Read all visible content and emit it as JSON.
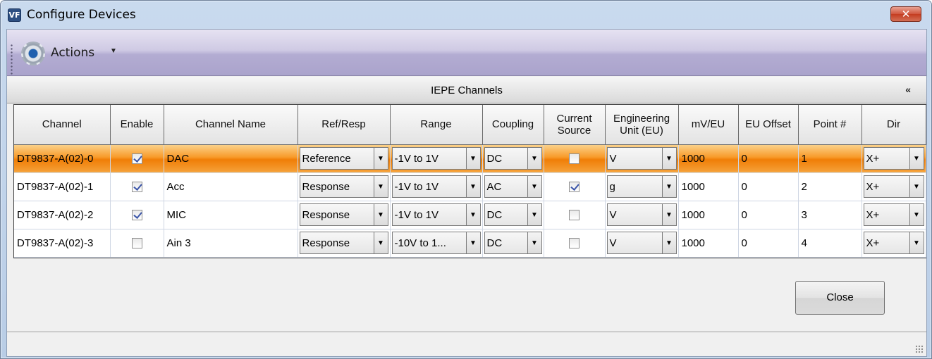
{
  "window": {
    "icon_text": "VF",
    "title": "Configure Devices",
    "close_glyph": "✕"
  },
  "toolbar": {
    "actions_label": "Actions",
    "actions_icon": "gear-icon"
  },
  "grid": {
    "caption": "IEPE Channels",
    "collapse_glyph": "≈",
    "columns": [
      "Channel",
      "Enable",
      "Channel Name",
      "Ref/Resp",
      "Range",
      "Coupling",
      "Current Source",
      "Engineering Unit (EU)",
      "mV/EU",
      "EU Offset",
      "Point #",
      "Dir"
    ],
    "rows": [
      {
        "channel": "DT9837-A(02)-0",
        "enable": true,
        "name": "DAC",
        "ref_resp": "Reference",
        "range": "-1V to 1V",
        "coupling": "DC",
        "current_source": false,
        "eu": "V",
        "mv_eu": "1000",
        "eu_offset": "0",
        "point": "1",
        "dir": "X+"
      },
      {
        "channel": "DT9837-A(02)-1",
        "enable": true,
        "name": "Acc",
        "ref_resp": "Response",
        "range": "-1V to 1V",
        "coupling": "AC",
        "current_source": true,
        "eu": "g",
        "mv_eu": "1000",
        "eu_offset": "0",
        "point": "2",
        "dir": "X+"
      },
      {
        "channel": "DT9837-A(02)-2",
        "enable": true,
        "name": "MIC",
        "ref_resp": "Response",
        "range": "-1V to 1V",
        "coupling": "DC",
        "current_source": false,
        "eu": "V",
        "mv_eu": "1000",
        "eu_offset": "0",
        "point": "3",
        "dir": "X+"
      },
      {
        "channel": "DT9837-A(02)-3",
        "enable": false,
        "name": "Ain 3",
        "ref_resp": "Response",
        "range": "-10V to 1...",
        "coupling": "DC",
        "current_source": false,
        "eu": "V",
        "mv_eu": "1000",
        "eu_offset": "0",
        "point": "4",
        "dir": "X+"
      }
    ],
    "selected_row": 0
  },
  "footer": {
    "close_label": "Close"
  },
  "colors": {
    "selected_row": "#f89b2b",
    "title_bar": "#c9daee",
    "toolbar": "#cfcae4"
  }
}
